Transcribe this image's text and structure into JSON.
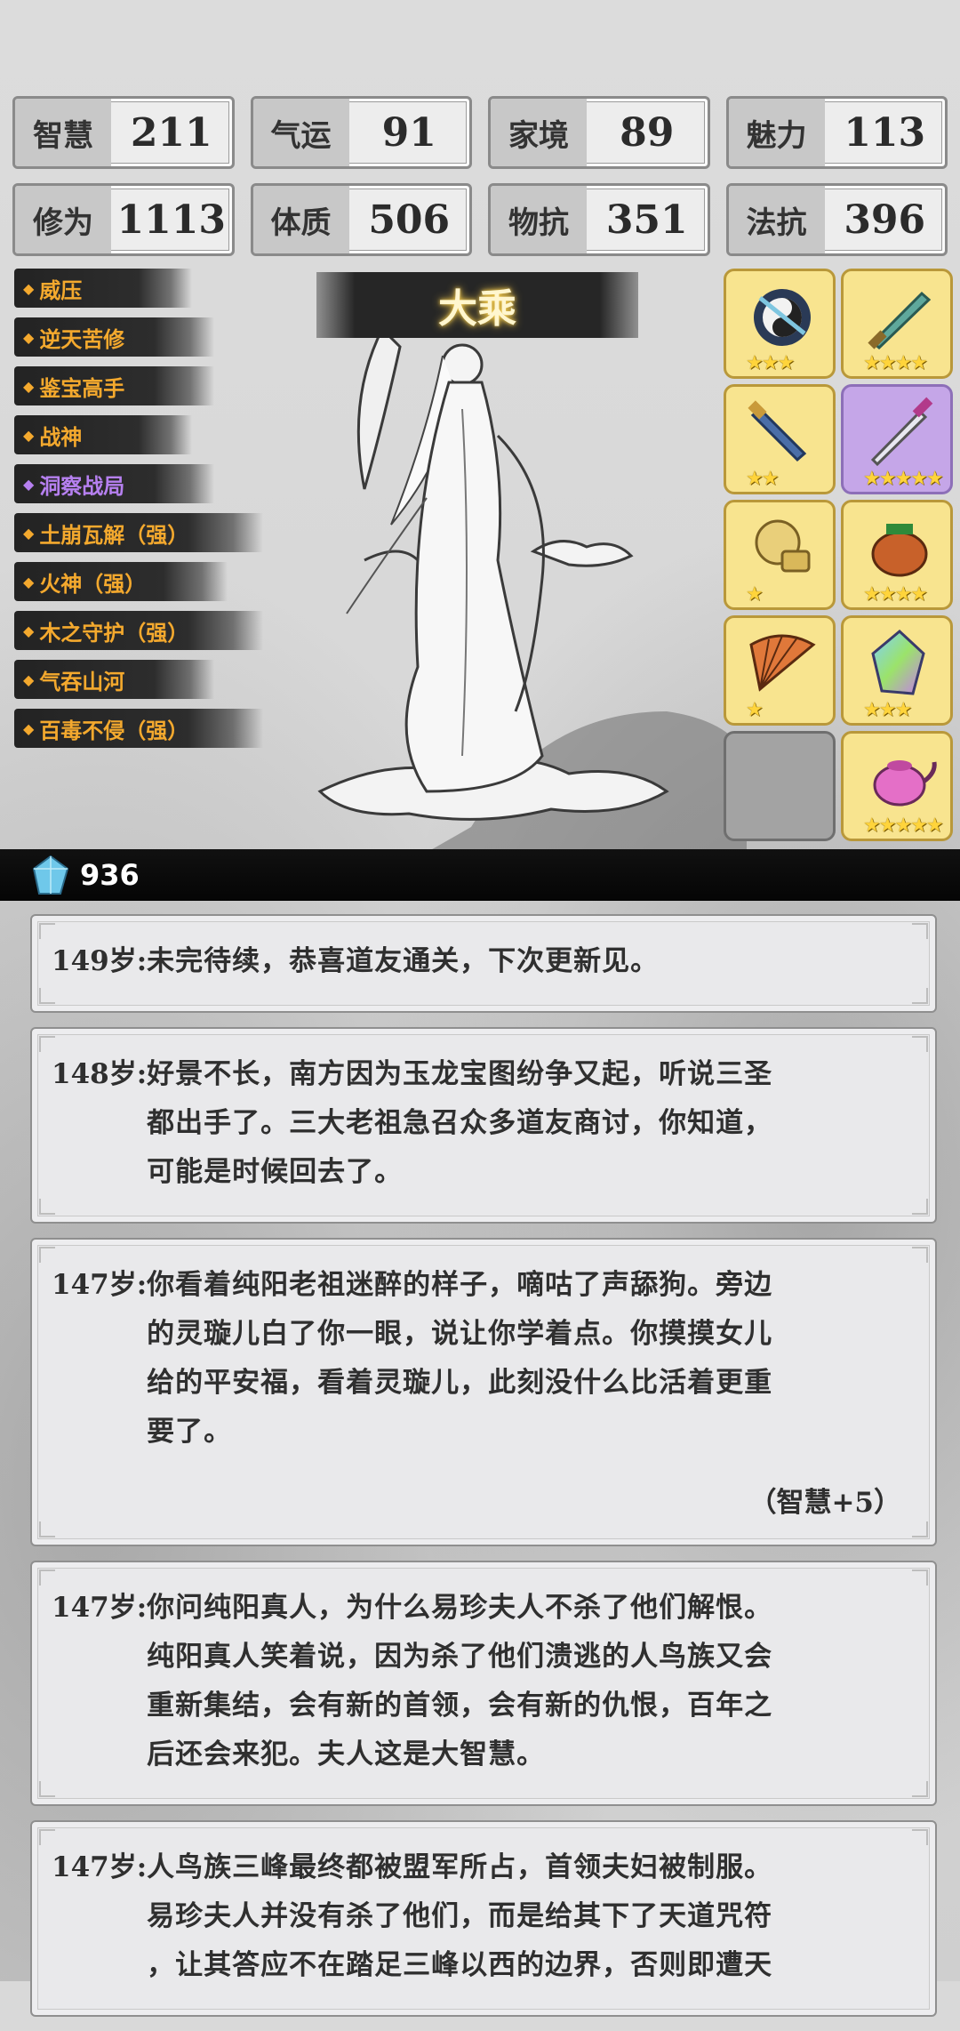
{
  "stats": [
    {
      "label": "智慧",
      "value": "211"
    },
    {
      "label": "气运",
      "value": "91"
    },
    {
      "label": "家境",
      "value": "89"
    },
    {
      "label": "魅力",
      "value": "113"
    },
    {
      "label": "修为",
      "value": "1113"
    },
    {
      "label": "体质",
      "value": "506"
    },
    {
      "label": "物抗",
      "value": "351"
    },
    {
      "label": "法抗",
      "value": "396"
    }
  ],
  "realm": "大乘",
  "skills": [
    {
      "label": "威压",
      "color": "#f4a92e"
    },
    {
      "label": "逆天苦修",
      "color": "#f4a92e"
    },
    {
      "label": "鉴宝高手",
      "color": "#f4a92e"
    },
    {
      "label": "战神",
      "color": "#f4a92e"
    },
    {
      "label": "洞察战局",
      "color": "#b680f0"
    },
    {
      "label": "土崩瓦解（强）",
      "color": "#f4a92e"
    },
    {
      "label": "火神（强）",
      "color": "#f4a92e"
    },
    {
      "label": "木之守护（强）",
      "color": "#f4a92e"
    },
    {
      "label": "气吞山河",
      "color": "#f4a92e"
    },
    {
      "label": "百毒不侵（强）",
      "color": "#f4a92e"
    }
  ],
  "equipment": [
    {
      "icon": "yin-yang-orb-icon",
      "stars": "★★★"
    },
    {
      "icon": "jade-sword-icon",
      "stars": "★★★★"
    },
    {
      "icon": "blue-sword-icon",
      "stars": "★★"
    },
    {
      "icon": "purple-sword-icon",
      "stars": "★★★★★"
    },
    {
      "icon": "golden-gauntlet-icon",
      "stars": "★"
    },
    {
      "icon": "bronze-cauldron-icon",
      "stars": "★★★★"
    },
    {
      "icon": "fan-icon",
      "stars": "★"
    },
    {
      "icon": "rainbow-crystal-icon",
      "stars": "★★★"
    },
    {
      "icon": "empty-slot",
      "stars": ""
    },
    {
      "icon": "teapot-icon",
      "stars": "★★★★★"
    }
  ],
  "crystals": "936",
  "log": [
    {
      "age": "149岁:",
      "lines": [
        "未完待续，恭喜道友通关，下次更新见。"
      ],
      "gain": ""
    },
    {
      "age": "148岁:",
      "lines": [
        "好景不长，南方因为玉龙宝图纷争又起，听说三圣",
        "都出手了。三大老祖急召众多道友商讨，你知道，",
        "可能是时候回去了。"
      ],
      "gain": ""
    },
    {
      "age": "147岁:",
      "lines": [
        "你看着纯阳老祖迷醉的样子，嘀咕了声舔狗。旁边",
        "的灵璇儿白了你一眼，说让你学着点。你摸摸女儿",
        "给的平安福，看着灵璇儿，此刻没什么比活着更重",
        "要了。"
      ],
      "gain": "（智慧+5）"
    },
    {
      "age": "147岁:",
      "lines": [
        "你问纯阳真人，为什么易珍夫人不杀了他们解恨。",
        "纯阳真人笑着说，因为杀了他们溃逃的人鸟族又会",
        "重新集结，会有新的首领，会有新的仇恨，百年之",
        "后还会来犯。夫人这是大智慧。"
      ],
      "gain": ""
    },
    {
      "age": "147岁:",
      "lines": [
        "人鸟族三峰最终都被盟军所占，首领夫妇被制服。",
        "易珍夫人并没有杀了他们，而是给其下了天道咒符",
        "，让其答应不在踏足三峰以西的边界，否则即遭天"
      ],
      "gain": ""
    }
  ]
}
